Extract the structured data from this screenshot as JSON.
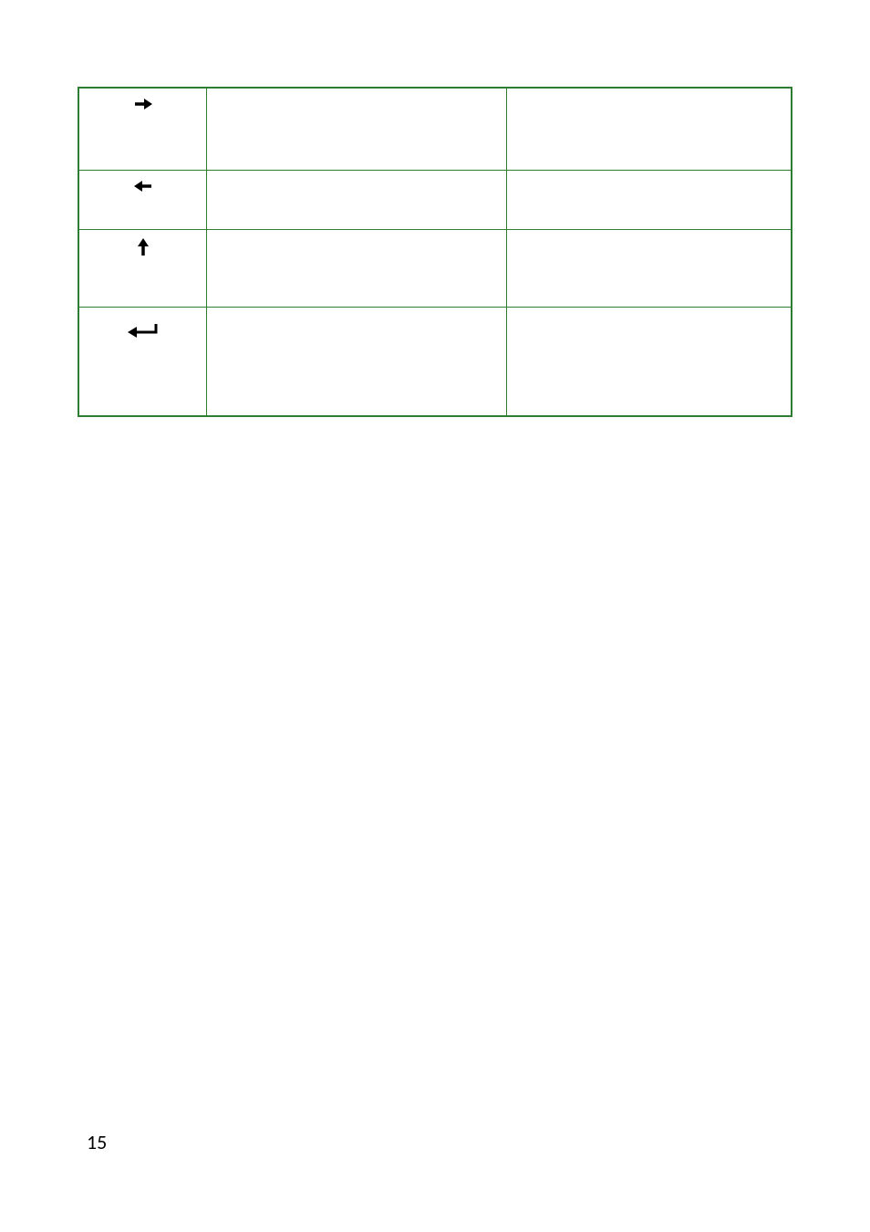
{
  "table": {
    "rows": [
      {
        "icon": "arrow-right",
        "col2": "",
        "col3": ""
      },
      {
        "icon": "arrow-left",
        "col2": "",
        "col3": ""
      },
      {
        "icon": "arrow-up",
        "col2": "",
        "col3": ""
      },
      {
        "icon": "return-arrow",
        "col2": "",
        "col3": ""
      }
    ]
  },
  "pageNumber": "15"
}
